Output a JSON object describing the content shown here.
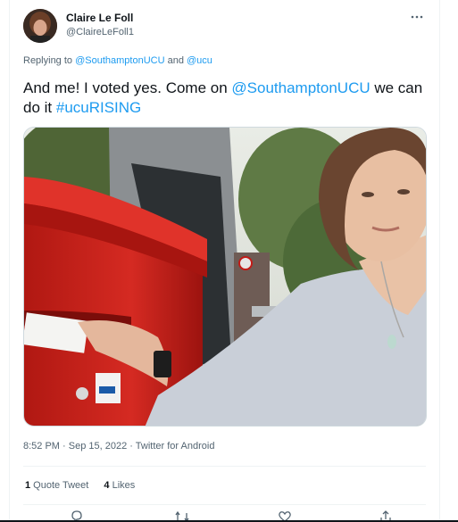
{
  "author": {
    "name": "Claire Le Foll",
    "handle": "@ClaireLeFoll1"
  },
  "more_icon": "more-horizontal-icon",
  "replying": {
    "prefix": "Replying to ",
    "mention1": "@SouthamptonUCU",
    "and": " and ",
    "mention2": "@ucu"
  },
  "tweet": {
    "part1": "And me! I voted yes. Come on ",
    "mention": "@SouthamptonUCU",
    "part2": " we can do it ",
    "hashtag": "#ucuRISING"
  },
  "meta": {
    "time": "8:52 PM",
    "dot1": " · ",
    "date": "Sep 15, 2022",
    "dot2": " · ",
    "source": "Twitter for Android"
  },
  "stats": {
    "quote_count": "1",
    "quote_label": " Quote Tweet",
    "likes_count": "4",
    "likes_label": " Likes"
  },
  "actions": [
    "reply-icon",
    "retweet-icon",
    "like-icon",
    "share-icon"
  ],
  "colors": {
    "link": "#1d9bf0",
    "secondary_text": "#536471",
    "postbox_red": "#c8201c"
  }
}
